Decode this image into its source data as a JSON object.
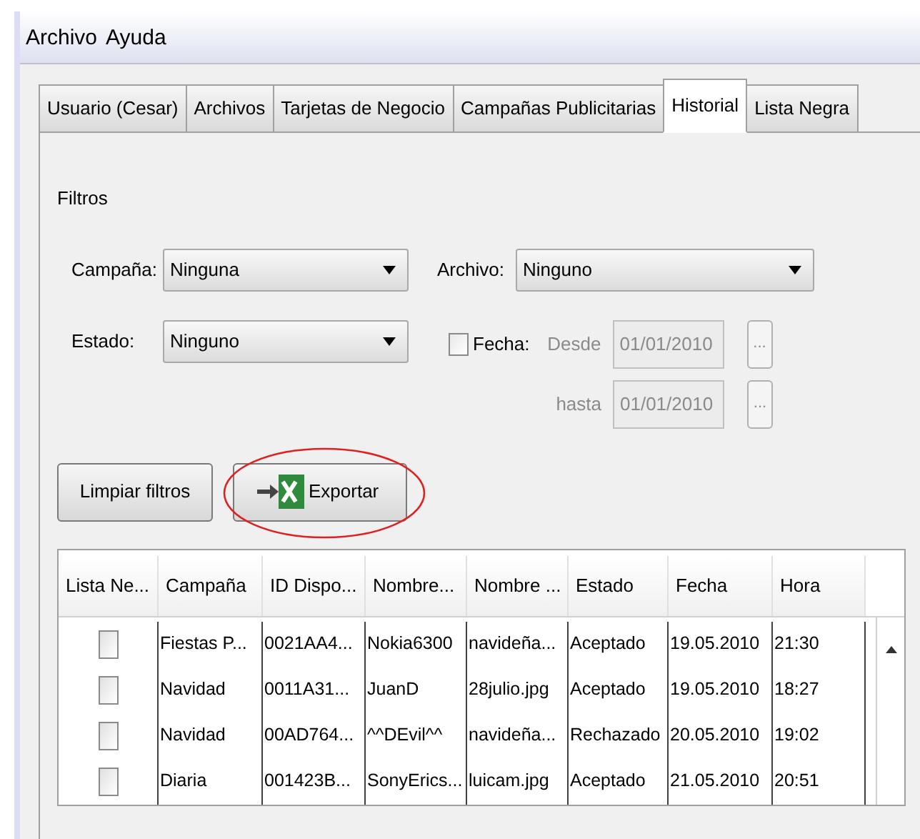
{
  "menu": [
    "Archivo",
    "Ayuda"
  ],
  "tabs": [
    {
      "label": "Usuario (Cesar)",
      "selected": false
    },
    {
      "label": "Archivos",
      "selected": false
    },
    {
      "label": "Tarjetas de Negocio",
      "selected": false
    },
    {
      "label": "Campañas Publicitarias",
      "selected": false
    },
    {
      "label": "Historial",
      "selected": true
    },
    {
      "label": "Lista Negra",
      "selected": false
    }
  ],
  "filters": {
    "title": "Filtros",
    "campaign": {
      "label": "Campaña:",
      "value": "Ninguna"
    },
    "file": {
      "label": "Archivo:",
      "value": "Ninguno"
    },
    "status": {
      "label": "Estado:",
      "value": "Ninguno"
    },
    "date": {
      "label": "Fecha:",
      "checked": false,
      "disabled": true,
      "from": {
        "label": "Desde",
        "value": "01/01/2010",
        "button": "..."
      },
      "to": {
        "label": "hasta",
        "value": "01/01/2010",
        "button": "..."
      }
    }
  },
  "buttons": {
    "clear": "Limpiar filtros",
    "export": "Exportar"
  },
  "table": {
    "columns": [
      "Lista Ne...",
      "Campaña",
      "ID Dispo...",
      "Nombre...",
      "Nombre ...",
      "Estado",
      "Fecha",
      "Hora"
    ],
    "rows": [
      {
        "cells": [
          {
            "kind": "checkbox",
            "checked": false
          },
          {
            "kind": "text",
            "text": "Fiestas P..."
          },
          {
            "kind": "text",
            "text": "0021AA4..."
          },
          {
            "kind": "text",
            "text": "Nokia6300"
          },
          {
            "kind": "text",
            "text": "navideña..."
          },
          {
            "kind": "text",
            "text": "Aceptado"
          },
          {
            "kind": "text",
            "text": "19.05.2010"
          },
          {
            "kind": "text",
            "text": "21:30"
          }
        ]
      },
      {
        "cells": [
          {
            "kind": "checkbox",
            "checked": false
          },
          {
            "kind": "text",
            "text": "Navidad"
          },
          {
            "kind": "text",
            "text": "0011A31..."
          },
          {
            "kind": "text",
            "text": "JuanD"
          },
          {
            "kind": "text",
            "text": "28julio.jpg"
          },
          {
            "kind": "text",
            "text": "Aceptado"
          },
          {
            "kind": "text",
            "text": "19.05.2010"
          },
          {
            "kind": "text",
            "text": "18:27"
          }
        ]
      },
      {
        "cells": [
          {
            "kind": "checkbox",
            "checked": false
          },
          {
            "kind": "text",
            "text": "Navidad"
          },
          {
            "kind": "text",
            "text": "00AD764..."
          },
          {
            "kind": "text",
            "text": "^^DEvil^^"
          },
          {
            "kind": "text",
            "text": "navideña..."
          },
          {
            "kind": "text",
            "text": "Rechazado"
          },
          {
            "kind": "text",
            "text": "20.05.2010"
          },
          {
            "kind": "text",
            "text": "19:02"
          }
        ]
      },
      {
        "cells": [
          {
            "kind": "checkbox",
            "checked": false
          },
          {
            "kind": "text",
            "text": "Diaria"
          },
          {
            "kind": "text",
            "text": "001423B..."
          },
          {
            "kind": "text",
            "text": "SonyErics..."
          },
          {
            "kind": "text",
            "text": "luicam.jpg"
          },
          {
            "kind": "text",
            "text": "Aceptado"
          },
          {
            "kind": "text",
            "text": "21.05.2010"
          },
          {
            "kind": "text",
            "text": "20:51"
          }
        ]
      }
    ]
  }
}
